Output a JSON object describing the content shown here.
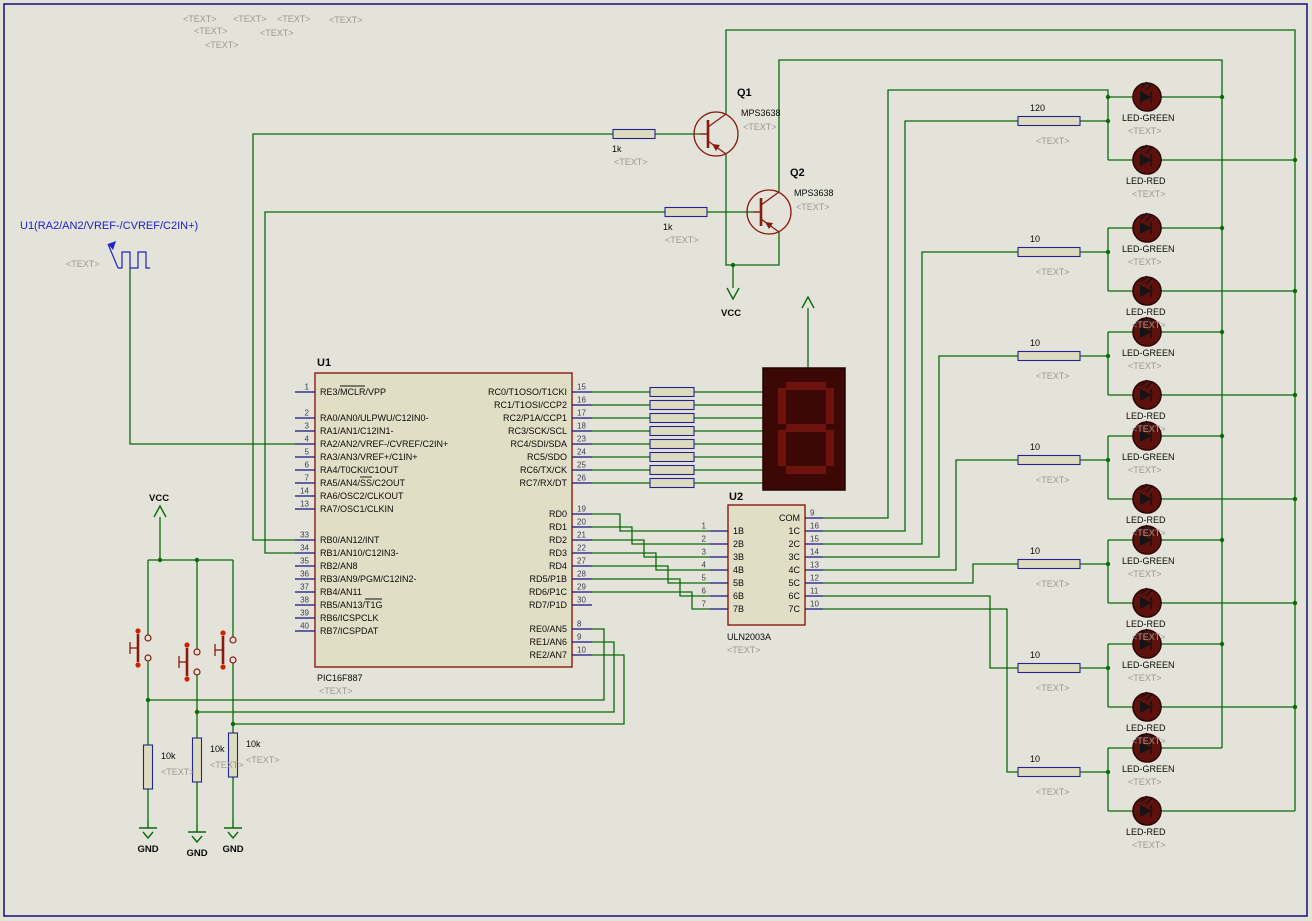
{
  "placeholder": "<TEXT>",
  "colors": {
    "background": "#e3e3da",
    "wire_green": "#0a6b0a",
    "component_maroon": "#8a1a10",
    "pin_navy": "#16167e",
    "led_body": "#5e100d",
    "display_body": "#3c0806",
    "display_segment": "#6d120c",
    "label_blue": "#2121c8",
    "placeholder_grey": "#9a9a90",
    "marker_red": "#cc2200",
    "sheet_border": "#10107a"
  },
  "generator": {
    "label": "U1(RA2/AN2/VREF-/CVREF/C2IN+)"
  },
  "u1": {
    "ref": "U1",
    "part": "PIC16F887",
    "left_pins": [
      {
        "num": "1",
        "name": "RE3/MCLR/VPP"
      },
      {
        "num": "2",
        "name": "RA0/AN0/ULPWU/C12IN0-"
      },
      {
        "num": "3",
        "name": "RA1/AN1/C12IN1-"
      },
      {
        "num": "4",
        "name": "RA2/AN2/VREF-/CVREF/C2IN+"
      },
      {
        "num": "5",
        "name": "RA3/AN3/VREF+/C1IN+"
      },
      {
        "num": "6",
        "name": "RA4/T0CKI/C1OUT"
      },
      {
        "num": "7",
        "name": "RA5/AN4/SS/C2OUT"
      },
      {
        "num": "14",
        "name": "RA6/OSC2/CLKOUT"
      },
      {
        "num": "13",
        "name": "RA7/OSC1/CLKIN"
      },
      {
        "num": "33",
        "name": "RB0/AN12/INT"
      },
      {
        "num": "34",
        "name": "RB1/AN10/C12IN3-"
      },
      {
        "num": "35",
        "name": "RB2/AN8"
      },
      {
        "num": "36",
        "name": "RB3/AN9/PGM/C12IN2-"
      },
      {
        "num": "37",
        "name": "RB4/AN11"
      },
      {
        "num": "38",
        "name": "RB5/AN13/T1G"
      },
      {
        "num": "39",
        "name": "RB6/ICSPCLK"
      },
      {
        "num": "40",
        "name": "RB7/ICSPDAT"
      }
    ],
    "right_pins_rc": [
      {
        "num": "15",
        "name": "RC0/T1OSO/T1CKI"
      },
      {
        "num": "16",
        "name": "RC1/T1OSI/CCP2"
      },
      {
        "num": "17",
        "name": "RC2/P1A/CCP1"
      },
      {
        "num": "18",
        "name": "RC3/SCK/SCL"
      },
      {
        "num": "23",
        "name": "RC4/SDI/SDA"
      },
      {
        "num": "24",
        "name": "RC5/SDO"
      },
      {
        "num": "25",
        "name": "RC6/TX/CK"
      },
      {
        "num": "26",
        "name": "RC7/RX/DT"
      }
    ],
    "right_pins_rd": [
      {
        "num": "19",
        "name": "RD0"
      },
      {
        "num": "20",
        "name": "RD1"
      },
      {
        "num": "21",
        "name": "RD2"
      },
      {
        "num": "22",
        "name": "RD3"
      },
      {
        "num": "27",
        "name": "RD4"
      },
      {
        "num": "28",
        "name": "RD5/P1B"
      },
      {
        "num": "29",
        "name": "RD6/P1C"
      },
      {
        "num": "30",
        "name": "RD7/P1D"
      }
    ],
    "right_pins_re": [
      {
        "num": "8",
        "name": "RE0/AN5"
      },
      {
        "num": "9",
        "name": "RE1/AN6"
      },
      {
        "num": "10",
        "name": "RE2/AN7"
      }
    ]
  },
  "u2": {
    "ref": "U2",
    "part": "ULN2003A",
    "left_pins": [
      {
        "num": "1",
        "name": "1B"
      },
      {
        "num": "2",
        "name": "2B"
      },
      {
        "num": "3",
        "name": "3B"
      },
      {
        "num": "4",
        "name": "4B"
      },
      {
        "num": "5",
        "name": "5B"
      },
      {
        "num": "6",
        "name": "6B"
      },
      {
        "num": "7",
        "name": "7B"
      }
    ],
    "right_pins": [
      {
        "num": "9",
        "name": "COM"
      },
      {
        "num": "16",
        "name": "1C"
      },
      {
        "num": "15",
        "name": "2C"
      },
      {
        "num": "14",
        "name": "3C"
      },
      {
        "num": "13",
        "name": "4C"
      },
      {
        "num": "12",
        "name": "5C"
      },
      {
        "num": "11",
        "name": "6C"
      },
      {
        "num": "10",
        "name": "7C"
      }
    ]
  },
  "transistors": [
    {
      "ref": "Q1",
      "part": "MPS3638"
    },
    {
      "ref": "Q2",
      "part": "MPS3638"
    }
  ],
  "base_resistors": [
    {
      "value": "1k"
    },
    {
      "value": "1k"
    }
  ],
  "led_groups": [
    {
      "resistor": "120",
      "green_label": "LED-GREEN",
      "red_label": "LED-RED"
    },
    {
      "resistor": "10",
      "green_label": "LED-GREEN",
      "red_label": "LED-RED"
    },
    {
      "resistor": "10",
      "green_label": "LED-GREEN",
      "red_label": "LED-RED"
    },
    {
      "resistor": "10",
      "green_label": "LED-GREEN",
      "red_label": "LED-RED"
    },
    {
      "resistor": "10",
      "green_label": "LED-GREEN",
      "red_label": "LED-RED"
    },
    {
      "resistor": "10",
      "green_label": "LED-GREEN",
      "red_label": "LED-RED"
    },
    {
      "resistor": "10",
      "green_label": "LED-GREEN",
      "red_label": "LED-RED"
    }
  ],
  "pulldown_resistors": [
    {
      "value": "10k"
    },
    {
      "value": "10k"
    },
    {
      "value": "10k"
    }
  ],
  "power": {
    "vcc": "VCC",
    "gnd": "GND"
  }
}
